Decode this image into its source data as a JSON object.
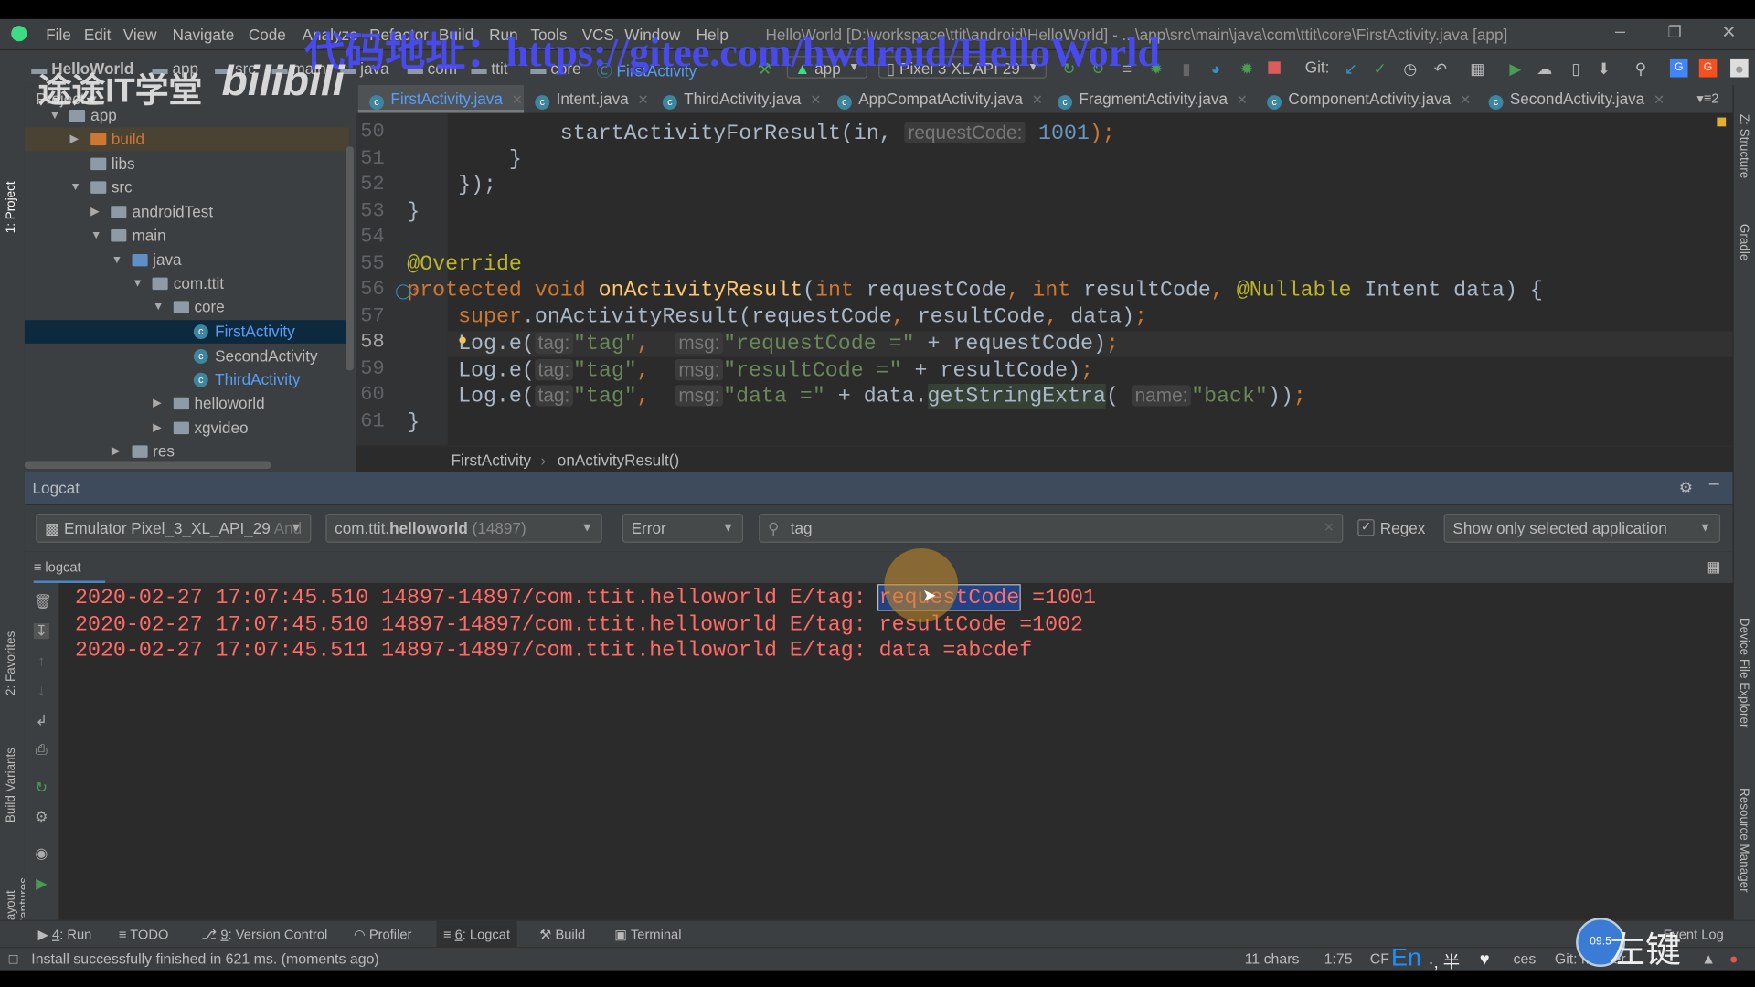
{
  "window": {
    "title": "HelloWorld [D:\\workspace\\ttit\\android\\HelloWorld] - ...\\app\\src\\main\\java\\com\\ttit\\core\\FirstActivity.java [app]",
    "menu": [
      "File",
      "Edit",
      "View",
      "Navigate",
      "Code",
      "Analyze",
      "Refactor",
      "Build",
      "Run",
      "Tools",
      "VCS",
      "Window",
      "Help"
    ]
  },
  "navbar": {
    "breadcrumbs": [
      "HelloWorld",
      "app",
      "src",
      "main",
      "java",
      "com",
      "ttit",
      "core",
      "FirstActivity"
    ],
    "run_config": "app",
    "device": "Pixel 3 XL API 29",
    "git_label": "Git:"
  },
  "left_strip": [
    "1: Project",
    "2: Favorites",
    "Build Variants",
    "Layout Captures"
  ],
  "right_strip": [
    "Z: Structure",
    "Gradle",
    "Device File Explorer",
    "Resource Manager"
  ],
  "project": {
    "header": "Project",
    "tree": [
      {
        "label": "app",
        "kind": "module",
        "expanded": true
      },
      {
        "label": "build",
        "kind": "folder-excluded",
        "expanded": false
      },
      {
        "label": "libs",
        "kind": "folder"
      },
      {
        "label": "src",
        "kind": "folder",
        "expanded": true
      },
      {
        "label": "androidTest",
        "kind": "folder",
        "expanded": false
      },
      {
        "label": "main",
        "kind": "folder",
        "expanded": true
      },
      {
        "label": "java",
        "kind": "source-folder",
        "expanded": true
      },
      {
        "label": "com.ttit",
        "kind": "package",
        "expanded": true
      },
      {
        "label": "core",
        "kind": "package",
        "expanded": true
      },
      {
        "label": "FirstActivity",
        "kind": "class",
        "selected": true
      },
      {
        "label": "SecondActivity",
        "kind": "class"
      },
      {
        "label": "ThirdActivity",
        "kind": "class"
      },
      {
        "label": "helloworld",
        "kind": "package",
        "expanded": false
      },
      {
        "label": "xgvideo",
        "kind": "package",
        "expanded": false
      },
      {
        "label": "res",
        "kind": "folder",
        "expanded": false
      }
    ]
  },
  "tabs": [
    "FirstActivity.java",
    "Intent.java",
    "ThirdActivity.java",
    "AppCompatActivity.java",
    "FragmentActivity.java",
    "ComponentActivity.java",
    "SecondActivity.java"
  ],
  "tabs_overflow": "2",
  "editor": {
    "current_line": 58,
    "lines": [
      {
        "n": "50",
        "tokens": [
          {
            "t": "                startActivityForResult(in, "
          },
          {
            "t": "requestCode:",
            "c": "h"
          },
          {
            "t": " "
          },
          {
            "t": "1001",
            "c": "n"
          },
          {
            "t": ");",
            "c": "p"
          }
        ]
      },
      {
        "n": "51",
        "tokens": [
          {
            "t": "            }"
          }
        ]
      },
      {
        "n": "52",
        "tokens": [
          {
            "t": "        });"
          }
        ]
      },
      {
        "n": "53",
        "tokens": [
          {
            "t": "    }"
          }
        ]
      },
      {
        "n": "54",
        "tokens": []
      },
      {
        "n": "55",
        "tokens": [
          {
            "t": "    @Override",
            "c": "a"
          }
        ]
      },
      {
        "n": "56",
        "tokens": [
          {
            "t": "    protected void ",
            "c": "k"
          },
          {
            "t": "onActivityResult",
            "c": "f"
          },
          {
            "t": "("
          },
          {
            "t": "int ",
            "c": "k"
          },
          {
            "t": "requestCode"
          },
          {
            "t": ", ",
            "c": "p"
          },
          {
            "t": "int ",
            "c": "k"
          },
          {
            "t": "resultCode"
          },
          {
            "t": ", ",
            "c": "p"
          },
          {
            "t": "@Nullable ",
            "c": "a"
          },
          {
            "t": "Intent data) {"
          }
        ]
      },
      {
        "n": "57",
        "tokens": [
          {
            "t": "        super",
            "c": "k"
          },
          {
            "t": ".onActivityResult(requestCode"
          },
          {
            "t": ", ",
            "c": "p"
          },
          {
            "t": "resultCode"
          },
          {
            "t": ", ",
            "c": "p"
          },
          {
            "t": "data)"
          },
          {
            "t": ";",
            "c": "p"
          }
        ]
      },
      {
        "n": "58",
        "tokens": [
          {
            "t": "        Log."
          },
          {
            "t": "e("
          },
          {
            "t": "tag:",
            "c": "h"
          },
          {
            "t": "\"tag\"",
            "c": "s"
          },
          {
            "t": ",  ",
            "c": "p"
          },
          {
            "t": "msg:",
            "c": "h"
          },
          {
            "t": "\"requestCode =\"",
            "c": "s"
          },
          {
            "t": " + requestCode)"
          },
          {
            "t": ";",
            "c": "p"
          }
        ]
      },
      {
        "n": "59",
        "tokens": [
          {
            "t": "        Log."
          },
          {
            "t": "e("
          },
          {
            "t": "tag:",
            "c": "h"
          },
          {
            "t": "\"tag\"",
            "c": "s"
          },
          {
            "t": ",  ",
            "c": "p"
          },
          {
            "t": "msg:",
            "c": "h"
          },
          {
            "t": "\"resultCode =\"",
            "c": "s"
          },
          {
            "t": " + resultCode)"
          },
          {
            "t": ";",
            "c": "p"
          }
        ]
      },
      {
        "n": "60",
        "tokens": [
          {
            "t": "        Log."
          },
          {
            "t": "e("
          },
          {
            "t": "tag:",
            "c": "h"
          },
          {
            "t": "\"tag\"",
            "c": "s"
          },
          {
            "t": ",  ",
            "c": "p"
          },
          {
            "t": "msg:",
            "c": "h"
          },
          {
            "t": "\"data =\"",
            "c": "s"
          },
          {
            "t": " + data."
          },
          {
            "t": "getStringExtra",
            "c": "m"
          },
          {
            "t": "( "
          },
          {
            "t": "name:",
            "c": "h"
          },
          {
            "t": "\"back\"",
            "c": "s"
          },
          {
            "t": "))"
          },
          {
            "t": ";",
            "c": "p"
          }
        ]
      },
      {
        "n": "61",
        "tokens": [
          {
            "t": "    }"
          }
        ]
      }
    ],
    "breadcrumb": [
      "FirstActivity",
      "onActivityResult()"
    ]
  },
  "logcat": {
    "title": "Logcat",
    "device": "Emulator Pixel_3_XL_API_29",
    "device_suffix": "And",
    "process_prefix": "com.ttit.",
    "process_bold": "helloworld",
    "process_pid": "(14897)",
    "level": "Error",
    "search_value": "tag",
    "regex_label": "Regex",
    "regex_checked": true,
    "filter": "Show only selected application",
    "tab": "logcat",
    "lines": [
      {
        "prefix": "2020-02-27 17:07:45.510 14897-14897/com.ttit.helloworld E/tag: ",
        "sel": "requestCode",
        "rest": " =1001"
      },
      {
        "prefix": "2020-02-27 17:07:45.510 14897-14897/com.ttit.helloworld E/tag: ",
        "sel": "",
        "rest": "resultCode =1002"
      },
      {
        "prefix": "2020-02-27 17:07:45.511 14897-14897/com.ttit.helloworld E/tag: ",
        "sel": "",
        "rest": "data =abcdef"
      }
    ]
  },
  "bottom_tabs": [
    {
      "key": "4",
      "label": ": Run"
    },
    {
      "key": "",
      "label": "TODO"
    },
    {
      "key": "9",
      "label": ": Version Control"
    },
    {
      "key": "",
      "label": "Profiler"
    },
    {
      "key": "6",
      "label": ": Logcat"
    },
    {
      "key": "",
      "label": "Build"
    },
    {
      "key": "",
      "label": "Terminal"
    }
  ],
  "event_log": "Event Log",
  "status": {
    "message": "Install successfully finished in 621 ms. (moments ago)",
    "chars": "11 chars",
    "position": "1:75",
    "line_sep": "CF",
    "ime": "En",
    "ime_extra": "·, 半",
    "ces": "ces",
    "git": "Git: master"
  },
  "watermarks": {
    "url": "代码地址：https://gitee.com/hwdroid/HelloWorld",
    "school": "途途IT学堂",
    "logo": "bilibili",
    "click_hint": "左键",
    "clock": "09:5"
  },
  "colors": {
    "accent": "#589df6",
    "log_error": "#ff6b68",
    "selection": "#214283",
    "logcat_header": "#3d4b5c",
    "watermark": "#4a4cff"
  }
}
